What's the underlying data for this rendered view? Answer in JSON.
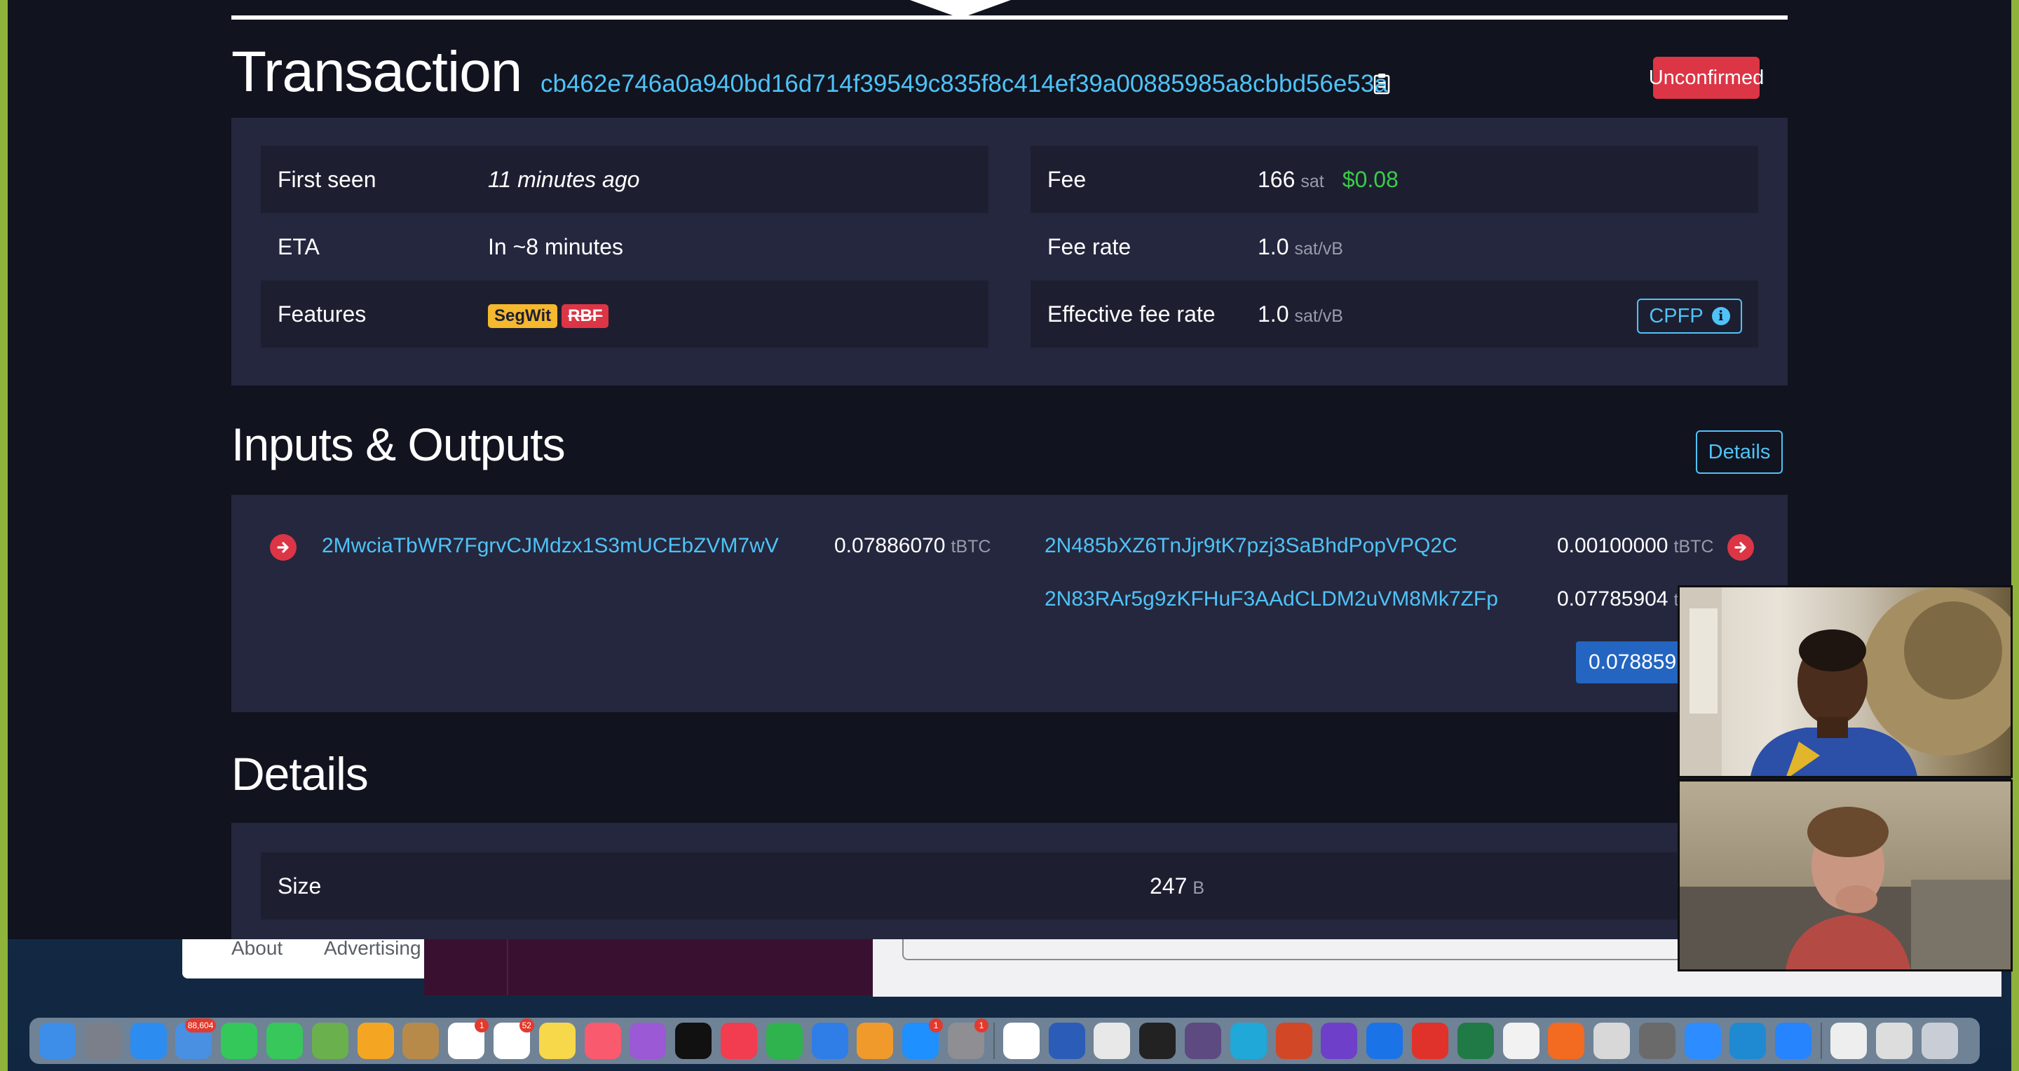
{
  "transaction": {
    "heading": "Transaction",
    "txid": "cb462e746a0a940bd16d714f39549c835f8c414ef39a00885985a8cbbd56e53a",
    "status": "Unconfirmed",
    "left_rows": [
      {
        "label": "First seen",
        "value": "11 minutes ago"
      },
      {
        "label": "ETA",
        "value": "In ~8 minutes"
      },
      {
        "label": "Features",
        "tags": [
          "SegWit",
          "RBF"
        ]
      }
    ],
    "right_rows": [
      {
        "label": "Fee",
        "value": "166",
        "unit": "sat",
        "fiat": "$0.08"
      },
      {
        "label": "Fee rate",
        "value": "1.0",
        "unit": "sat/vB"
      },
      {
        "label": "Effective fee rate",
        "value": "1.0",
        "unit": "sat/vB",
        "button": "CPFP"
      }
    ]
  },
  "io": {
    "heading": "Inputs & Outputs",
    "details_button": "Details",
    "inputs": [
      {
        "address": "2MwciaTbWR7FgrvCJMdzx1S3mUCEbZVM7wV",
        "amount": "0.07886070",
        "unit": "tBTC"
      }
    ],
    "outputs": [
      {
        "address": "2N485bXZ6TnJjr9tK7pzj3SaBhdPopVPQ2C",
        "amount": "0.00100000",
        "unit": "tBTC"
      },
      {
        "address": "2N83RAr5g9zKFHuF3AAdCLDM2uVM8Mk7ZFp",
        "amount": "0.07785904",
        "unit": "tB"
      }
    ],
    "total": "0.078859"
  },
  "details": {
    "heading": "Details",
    "rows": [
      {
        "label": "Size",
        "value": "247",
        "unit": "B"
      }
    ]
  },
  "footer": {
    "links": [
      "About",
      "Advertising"
    ]
  },
  "dock": {
    "apps": [
      {
        "icon": "finder-icon",
        "color": "#3d8ee8"
      },
      {
        "icon": "launchpad-icon",
        "color": "#7a7f8a"
      },
      {
        "icon": "safari-icon",
        "color": "#2d8cf0"
      },
      {
        "icon": "mail-icon",
        "color": "#4a90e2",
        "badge": "88,604"
      },
      {
        "icon": "facetime-icon",
        "color": "#34c759"
      },
      {
        "icon": "messages-icon",
        "color": "#37c75a"
      },
      {
        "icon": "maps-icon",
        "color": "#6ab04c"
      },
      {
        "icon": "photos-icon",
        "color": "#f4a623"
      },
      {
        "icon": "contacts-icon",
        "color": "#b88a4a"
      },
      {
        "icon": "calendar-icon",
        "color": "#ffffff",
        "badge": "1"
      },
      {
        "icon": "reminders-icon",
        "color": "#ffffff",
        "badge": "52"
      },
      {
        "icon": "notes-icon",
        "color": "#f7d84a"
      },
      {
        "icon": "music-icon",
        "color": "#fa5a6e"
      },
      {
        "icon": "podcasts-icon",
        "color": "#9b59d6"
      },
      {
        "icon": "tv-icon",
        "color": "#111111"
      },
      {
        "icon": "news-icon",
        "color": "#f23c4f"
      },
      {
        "icon": "numbers-icon",
        "color": "#2fb34e"
      },
      {
        "icon": "keynote-icon",
        "color": "#2f7ee8"
      },
      {
        "icon": "pages-icon",
        "color": "#f09a2b"
      },
      {
        "icon": "app-store-icon",
        "color": "#1e90ff",
        "badge": "1"
      },
      {
        "icon": "system-preferences-icon",
        "color": "#8e8e93",
        "badge": "1"
      },
      {
        "sep": true
      },
      {
        "icon": "slack-icon",
        "color": "#ffffff"
      },
      {
        "icon": "word-icon",
        "color": "#2b5cb8"
      },
      {
        "icon": "chrome-icon",
        "color": "#e8e8e8"
      },
      {
        "icon": "terminal-icon",
        "color": "#222222"
      },
      {
        "icon": "tor-icon",
        "color": "#5c4a80"
      },
      {
        "icon": "globe-icon",
        "color": "#1fa8d8"
      },
      {
        "icon": "powerpoint-icon",
        "color": "#d24726"
      },
      {
        "icon": "github-icon",
        "color": "#6e40c9"
      },
      {
        "icon": "bluetooth-icon",
        "color": "#1b73e8"
      },
      {
        "icon": "pdf-icon",
        "color": "#e0312b"
      },
      {
        "icon": "excel-icon",
        "color": "#1f7a45"
      },
      {
        "icon": "textedit-icon",
        "color": "#f2f2f2"
      },
      {
        "icon": "sketch-icon",
        "color": "#f26b21"
      },
      {
        "icon": "script-editor-icon",
        "color": "#d8d8d8"
      },
      {
        "icon": "pen-icon",
        "color": "#6a6a6a"
      },
      {
        "icon": "zoom-icon",
        "color": "#2d8cff"
      },
      {
        "icon": "vscode-icon",
        "color": "#1f8ad2"
      },
      {
        "icon": "sourcetree-icon",
        "color": "#2684ff"
      },
      {
        "sep": true
      },
      {
        "icon": "document-icon",
        "color": "#eeeeee"
      },
      {
        "icon": "screenshot-icon",
        "color": "#dddddd"
      },
      {
        "icon": "trash-icon",
        "color": "#c9ced6"
      }
    ]
  }
}
